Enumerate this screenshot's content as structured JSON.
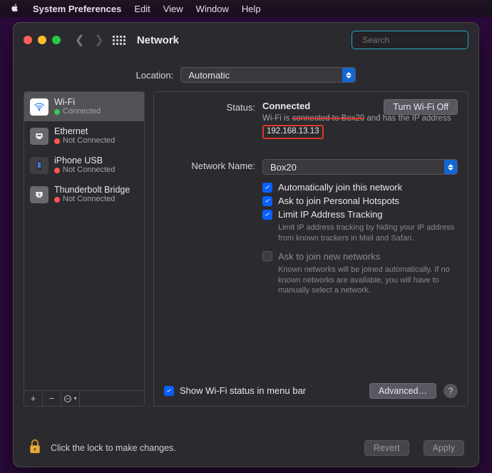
{
  "menubar": {
    "app": "System Preferences",
    "items": [
      "Edit",
      "View",
      "Window",
      "Help"
    ]
  },
  "toolbar": {
    "title": "Network",
    "search_placeholder": "Search"
  },
  "location": {
    "label": "Location:",
    "value": "Automatic"
  },
  "sidebar": {
    "items": [
      {
        "icon": "wifi",
        "name": "Wi-Fi",
        "status": "Connected",
        "dot": "green",
        "selected": true
      },
      {
        "icon": "eth",
        "name": "Ethernet",
        "status": "Not Connected",
        "dot": "red",
        "selected": false
      },
      {
        "icon": "iphone",
        "name": "iPhone USB",
        "status": "Not Connected",
        "dot": "red",
        "selected": false
      },
      {
        "icon": "tb",
        "name": "Thunderbolt Bridge",
        "status": "Not Connected",
        "dot": "red",
        "selected": false
      }
    ]
  },
  "status": {
    "label": "Status:",
    "value": "Connected",
    "toggle": "Turn Wi-Fi Off",
    "sub_prefix": "Wi-Fi is ",
    "sub_ssid_struck": "connected to Box20",
    "sub_mid": " and has the IP address ",
    "sub_ip": "192.168.13.13"
  },
  "network_name": {
    "label": "Network Name:",
    "value": "Box20"
  },
  "options": {
    "auto_join": "Automatically join this network",
    "hotspots": "Ask to join Personal Hotspots",
    "limit_ip": "Limit IP Address Tracking",
    "limit_ip_note": "Limit IP address tracking by hiding your IP address from known trackers in Mail and Safari.",
    "ask_new": "Ask to join new networks",
    "ask_new_note": "Known networks will be joined automatically. If no known networks are available, you will have to manually select a network."
  },
  "show_in_menubar": "Show Wi-Fi status in menu bar",
  "advanced": "Advanced…",
  "lock_text": "Click the lock to make changes.",
  "buttons": {
    "revert": "Revert",
    "apply": "Apply"
  }
}
